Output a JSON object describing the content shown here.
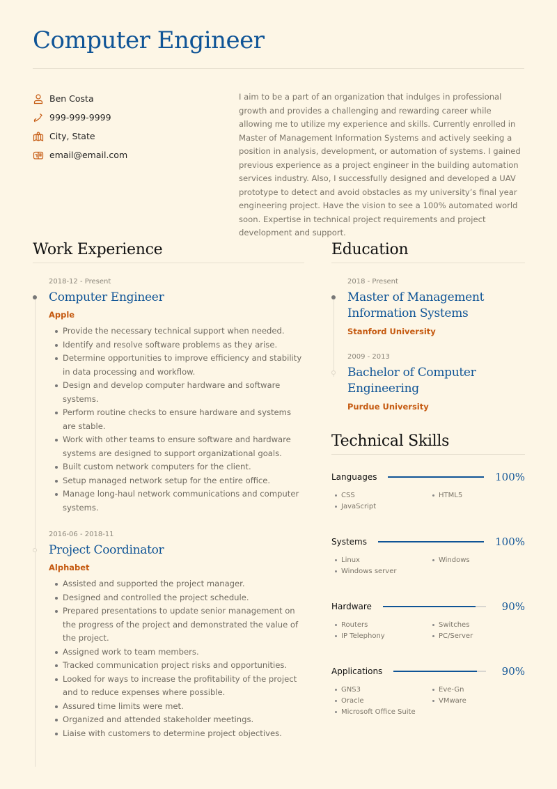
{
  "header": {
    "title": "Computer Engineer"
  },
  "contact": [
    {
      "icon": "person-icon",
      "text": "Ben Costa"
    },
    {
      "icon": "phone-icon",
      "text": "999-999-9999"
    },
    {
      "icon": "map-icon",
      "text": "City, State"
    },
    {
      "icon": "mailbox-icon",
      "text": "email@email.com"
    }
  ],
  "summary": "I aim to be a part of an organization that indulges in professional growth and provides a challenging and rewarding career while allowing me to utilize my experience and skills. Currently enrolled in Master of Management Information Systems and actively seeking a position in analysis, development, or automation of systems. I gained previous experience as a project engineer in the building automation services industry. Also, I successfully designed and developed a UAV prototype to detect and avoid obstacles as my university’s final year engineering project. Have the vision to see a 100% automated world soon. Expertise in technical project requirements and project development and support.",
  "work": {
    "title": "Work Experience",
    "entries": [
      {
        "date": "2018-12 - Present",
        "title": "Computer Engineer",
        "company": "Apple",
        "bullets": [
          "Provide the necessary technical support when needed.",
          "Identify and resolve software problems as they arise.",
          "Determine opportunities to improve efficiency and stability in data processing and workflow.",
          "Design and develop computer hardware and software systems.",
          "Perform routine checks to ensure hardware and systems are stable.",
          "Work with other teams to ensure software and hardware systems are designed to support organizational goals.",
          "Built custom network computers for the client.",
          "Setup managed network setup for the entire office.",
          "Manage long-haul network communications and computer systems."
        ]
      },
      {
        "date": "2016-06 - 2018-11",
        "title": "Project Coordinator",
        "company": "Alphabet",
        "bullets": [
          "Assisted and supported the project manager.",
          "Designed and controlled the project schedule.",
          "Prepared presentations to update senior management on the progress of the project and demonstrated the value of the project.",
          "Assigned work to team members.",
          "Tracked communication project risks and opportunities.",
          "Looked for ways to increase the profitability of the project and to reduce expenses where possible.",
          "Assured time limits were met.",
          "Organized and attended stakeholder meetings.",
          "Liaise with customers to determine project objectives."
        ]
      }
    ]
  },
  "education": {
    "title": "Education",
    "entries": [
      {
        "date": "2018 - Present",
        "title": "Master of Management Information Systems",
        "school": "Stanford University"
      },
      {
        "date": "2009 - 2013",
        "title": "Bachelor of Computer Engineering",
        "school": "Purdue University"
      }
    ]
  },
  "skills": {
    "title": "Technical Skills",
    "groups": [
      {
        "name": "Languages",
        "percent": 100,
        "label": "100%",
        "items": [
          "CSS",
          "HTML5",
          "JavaScript"
        ]
      },
      {
        "name": "Systems",
        "percent": 100,
        "label": "100%",
        "items": [
          "Linux",
          "Windows",
          "Windows server"
        ]
      },
      {
        "name": "Hardware",
        "percent": 90,
        "label": "90%",
        "items": [
          "Routers",
          "Switches",
          "IP Telephony",
          "PC/Server"
        ]
      },
      {
        "name": "Applications",
        "percent": 90,
        "label": "90%",
        "items": [
          "GNS3",
          "Eve-Gn",
          "Oracle",
          "VMware",
          "Microsoft Office Suite"
        ]
      }
    ]
  },
  "colors": {
    "accent": "#0f5496",
    "company": "#c55a11",
    "background": "#fdf6e6"
  }
}
